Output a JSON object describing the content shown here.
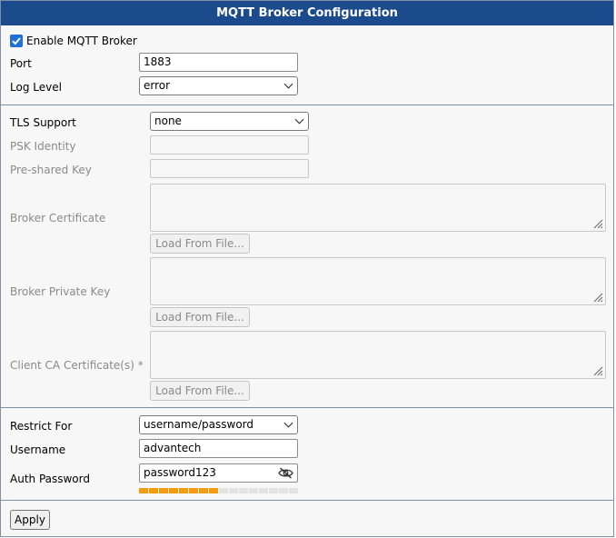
{
  "title": "MQTT Broker Configuration",
  "enable_broker": {
    "label": "Enable MQTT Broker",
    "checked": true
  },
  "port": {
    "label": "Port",
    "value": "1883"
  },
  "log_level": {
    "label": "Log Level",
    "value": "error"
  },
  "tls": {
    "support_label": "TLS Support",
    "support_value": "none",
    "psk_identity_label": "PSK Identity",
    "psk_label": "Pre-shared Key",
    "broker_cert_label": "Broker Certificate",
    "broker_key_label": "Broker Private Key",
    "client_ca_label": "Client CA Certificate(s) *",
    "load_from_file": "Load From File..."
  },
  "auth": {
    "restrict_label": "Restrict For",
    "restrict_value": "username/password",
    "username_label": "Username",
    "username_value": "advantech",
    "password_label": "Auth Password",
    "password_value": "password123",
    "strength_filled": 8,
    "strength_total": 16,
    "strength_color": "#f39c12",
    "strength_empty_color": "#e3e3e3"
  },
  "apply_label": "Apply",
  "colors": {
    "header": "#1b4b8c",
    "checkbox": "#1f6fd8"
  }
}
